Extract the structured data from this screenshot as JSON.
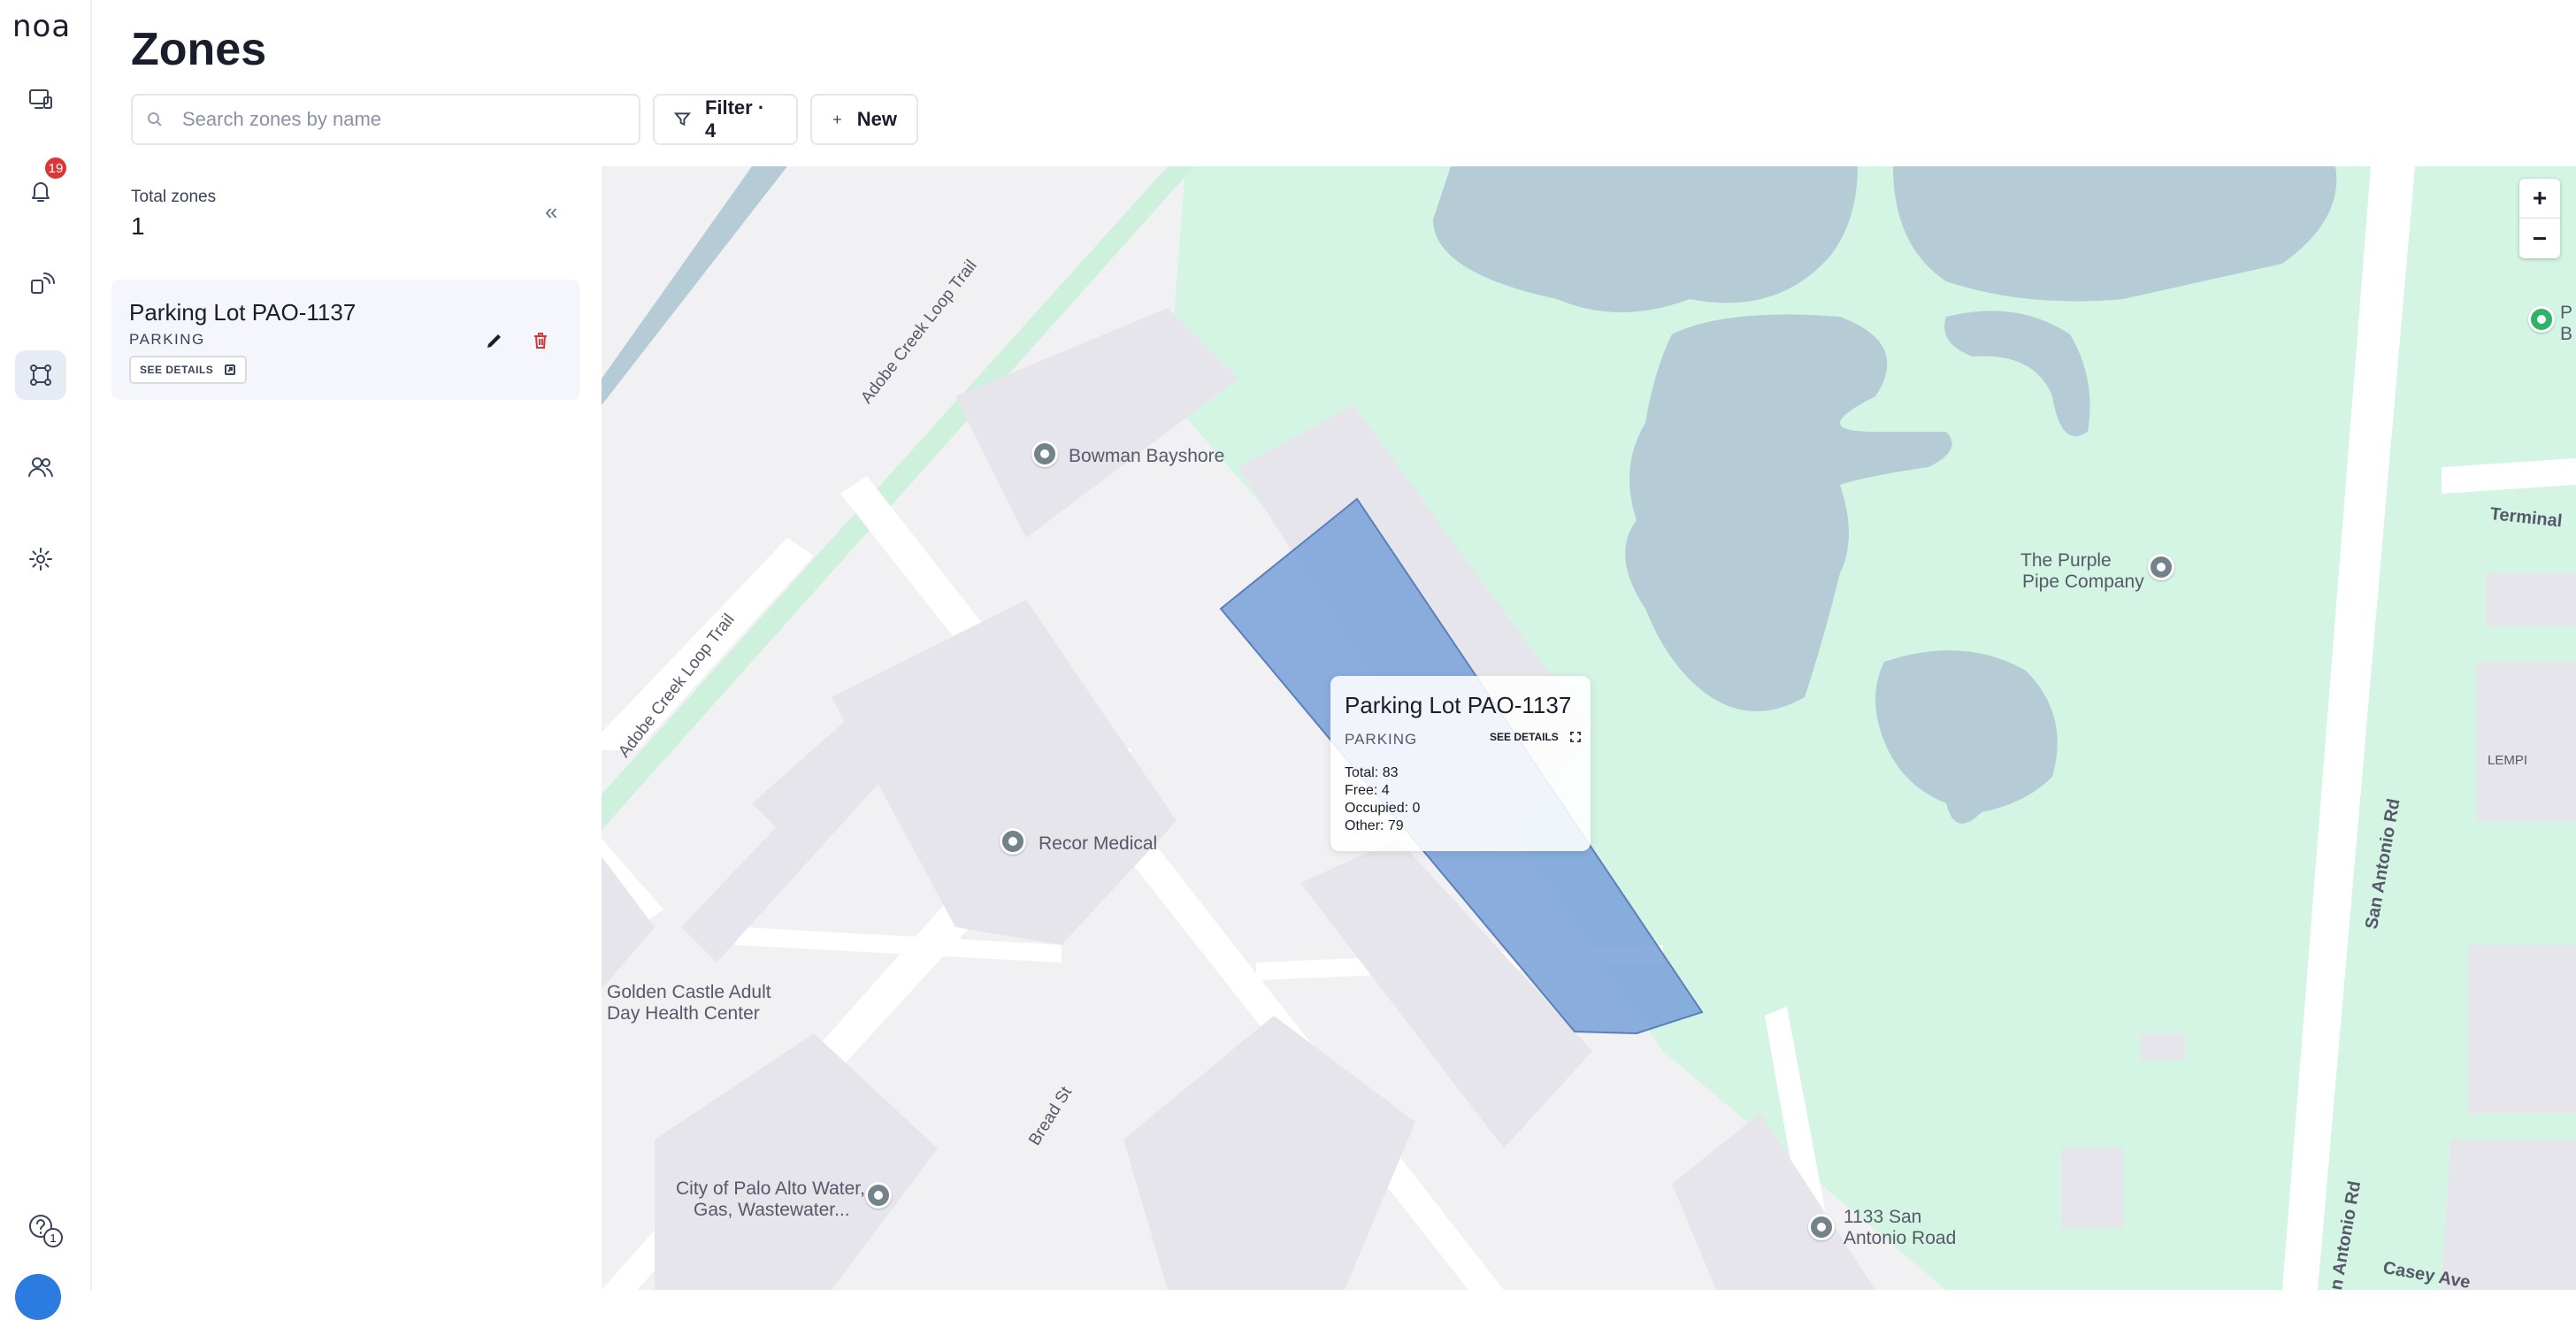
{
  "app": {
    "logo": "noa"
  },
  "nav": {
    "notifications_count": "19",
    "bottom_badge": "1"
  },
  "header": {
    "title": "Zones",
    "search_placeholder": "Search zones by name",
    "filter_label": "Filter · 4",
    "new_label": "New"
  },
  "panel": {
    "total_label": "Total zones",
    "total_value": "1",
    "collapse_glyph": "«",
    "zones": [
      {
        "name": "Parking Lot PAO-1137",
        "type": "PARKING",
        "see_details": "SEE DETAILS"
      }
    ]
  },
  "map": {
    "labels": {
      "bowman": "Bowman Bayshore",
      "recor": "Recor Medical",
      "golden_1": "Golden Castle Adult",
      "golden_2": "Day Health Center",
      "palo_1": "City of Palo Alto Water,",
      "palo_2": "Gas, Wastewater...",
      "purple_1": "The Purple",
      "purple_2": "Pipe Company",
      "sanantonio_1": "1133 San",
      "sanantonio_2": "Antonio Road",
      "trail_1": "Adobe Creek Loop Trail",
      "trail_2": "Adobe Creek Loop Trail",
      "bread_st": "Bread St",
      "san_antonio_rd": "San Antonio Rd",
      "san_antonio_rd_2": "n Antonio Rd",
      "casey_ave": "Casey Ave",
      "terminal": "Terminal",
      "lempi": "LEMPI",
      "edge_p": "P",
      "edge_b": "B"
    },
    "zoom_in": "+",
    "zoom_out": "−",
    "popup": {
      "title": "Parking Lot PAO-1137",
      "type": "PARKING",
      "see_details": "SEE DETAILS",
      "total": "Total: 83",
      "free": "Free: 4",
      "occupied": "Occupied: 0",
      "other": "Other: 79"
    },
    "colors": {
      "park": "#d4f5e3",
      "water": "#b5cbd6",
      "zone_fill": "#7ea5dc",
      "building": "#e6e5ec"
    }
  }
}
